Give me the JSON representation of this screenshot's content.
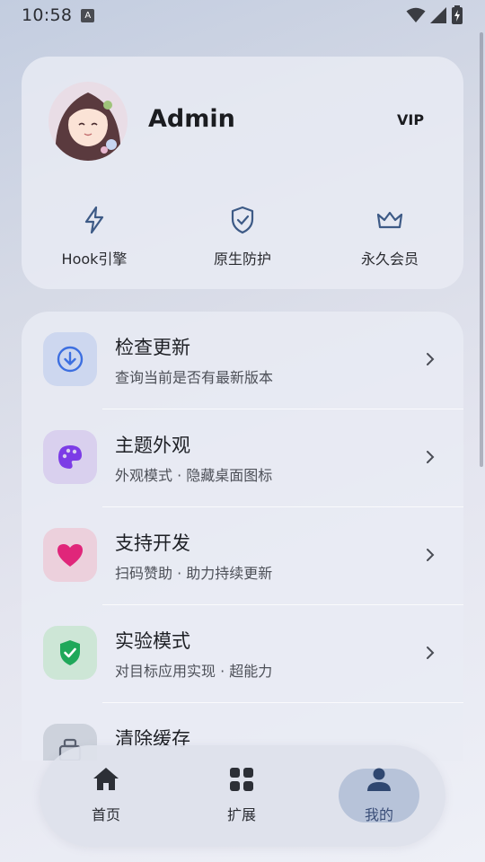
{
  "status_bar": {
    "time": "10:58",
    "notification_glyph": "A"
  },
  "profile": {
    "name": "Admin",
    "badge": "VIP"
  },
  "features": [
    {
      "icon": "lightning-icon",
      "label": "Hook引擎"
    },
    {
      "icon": "shield-check-icon",
      "label": "原生防护"
    },
    {
      "icon": "crown-icon",
      "label": "永久会员"
    }
  ],
  "settings": [
    {
      "icon": "download-icon",
      "title": "检查更新",
      "subtitle": "查询当前是否有最新版本",
      "icon_bg": "#cdd7ef",
      "icon_color": "#3d6fe0"
    },
    {
      "icon": "palette-icon",
      "title": "主题外观",
      "subtitle": "外观模式 · 隐藏桌面图标",
      "icon_bg": "#d9d0ee",
      "icon_color": "#7c3ce6"
    },
    {
      "icon": "heart-icon",
      "title": "支持开发",
      "subtitle": "扫码赞助 · 助力持续更新",
      "icon_bg": "#ecd0dc",
      "icon_color": "#e0267a"
    },
    {
      "icon": "shield-check-icon",
      "title": "实验模式",
      "subtitle": "对目标应用实现 · 超能力",
      "icon_bg": "#cde6d6",
      "icon_color": "#1fa85a"
    },
    {
      "icon": "broom-icon",
      "title": "清除缓存",
      "subtitle": "",
      "icon_bg": "#cdd2dc",
      "icon_color": "#5a6170"
    }
  ],
  "bottom_nav": [
    {
      "icon": "home-icon",
      "label": "首页",
      "active": false
    },
    {
      "icon": "grid-icon",
      "label": "扩展",
      "active": false
    },
    {
      "icon": "person-icon",
      "label": "我的",
      "active": true
    }
  ],
  "colors": {
    "accent": "#3a4e78",
    "nav_active_bg": "#b7c3d9"
  }
}
